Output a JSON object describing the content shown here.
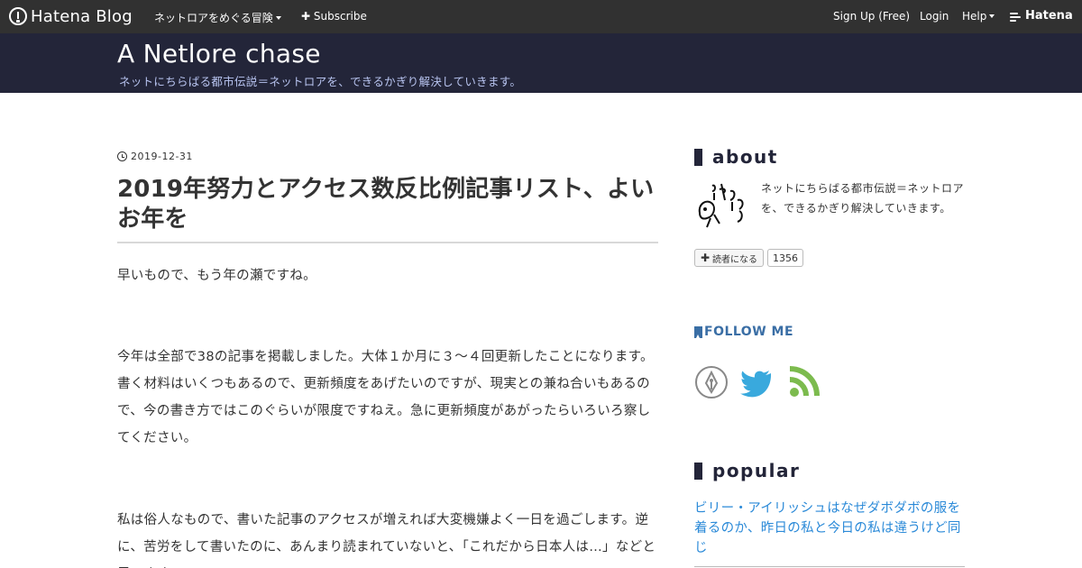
{
  "global_header": {
    "logo_text": "Hatena Blog",
    "menu_blog": "ネットロアをめぐる冒険",
    "menu_subscribe": "Subscribe",
    "menu_signup": "Sign Up (Free)",
    "menu_login": "Login",
    "menu_help": "Help",
    "brand": "Hatena"
  },
  "blog": {
    "title": "A Netlore chase",
    "description": "ネットにちらばる都市伝説＝ネットロアを、できるかぎり解決していきます。"
  },
  "entry": {
    "date": "2019-12-31",
    "title": "2019年努力とアクセス数反比例記事リスト、よいお年を",
    "paragraphs": [
      "早いもので、もう年の瀬ですね。",
      "今年は全部で38の記事を掲載しました。大体１か月に３～４回更新したことになります。書く材料はいくつもあるので、更新頻度をあげたいのですが、現実との兼ね合いもあるので、今の書き方ではこのぐらいが限度ですねえ。急に更新頻度があがったらいろいろ察してください。",
      "私は俗人なもので、書いた記事のアクセスが増えれば大変機嫌よく一日を過ごします。逆に、苦労をして書いたのに、あんまり読まれていないと、「これだから日本人は…」などと思います。"
    ]
  },
  "sidebar": {
    "about_heading": "about",
    "about_text": "ネットにちらばる都市伝説＝ネットロアを、できるかぎり解決していきます。",
    "subscribe_label": "読者になる",
    "subscriber_count": "1356",
    "follow_heading": "FOLLOW ME",
    "popular_heading": "popular",
    "popular_items": [
      "ビリー・アイリッシュはなぜダボダボの服を着るのか、昨日の私と今日の私は違うけど同じ"
    ]
  },
  "colors": {
    "global_header_bg": "#313131",
    "title_bg": "#232539",
    "description": "#b8c4f0",
    "link": "#2b8ad8",
    "follow_accent": "#3a6ea5",
    "twitter": "#39a9dd",
    "rss": "#7cbb4e"
  },
  "icons": {
    "date": "clock-icon",
    "follow": [
      "hatena-pen-icon",
      "twitter-icon",
      "rss-icon"
    ]
  }
}
